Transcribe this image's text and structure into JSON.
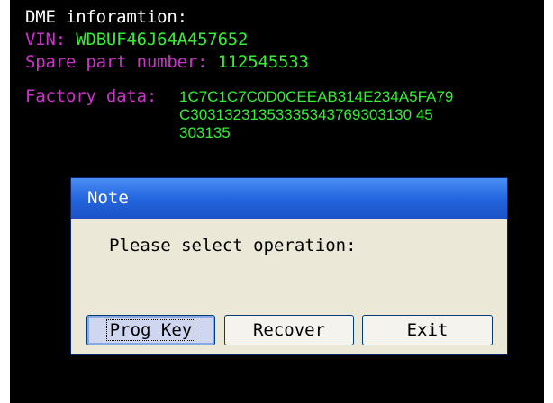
{
  "info": {
    "heading": "DME inforamtion:",
    "vin_label": "VIN:",
    "vin_value": "WDBUF46J64A457652",
    "spare_label": "Spare part number:",
    "spare_value": "112545533",
    "factory_label": "Factory data:",
    "factory_lines": [
      "1C7C1C7C0D0CEEAB314E234A5FA79",
      "C30313231353335343769303130 45",
      "303135"
    ]
  },
  "dialog": {
    "title": "Note",
    "message": "Please select operation:",
    "buttons": {
      "prog_key": "Prog Key",
      "recover": "Recover",
      "exit": "Exit"
    }
  },
  "colors": {
    "background": "#000000",
    "heading": "#ffffff",
    "label": "#cc33cc",
    "value": "#33ee33",
    "titlebar": "#2466de",
    "dialog_body": "#ebe8d8"
  }
}
